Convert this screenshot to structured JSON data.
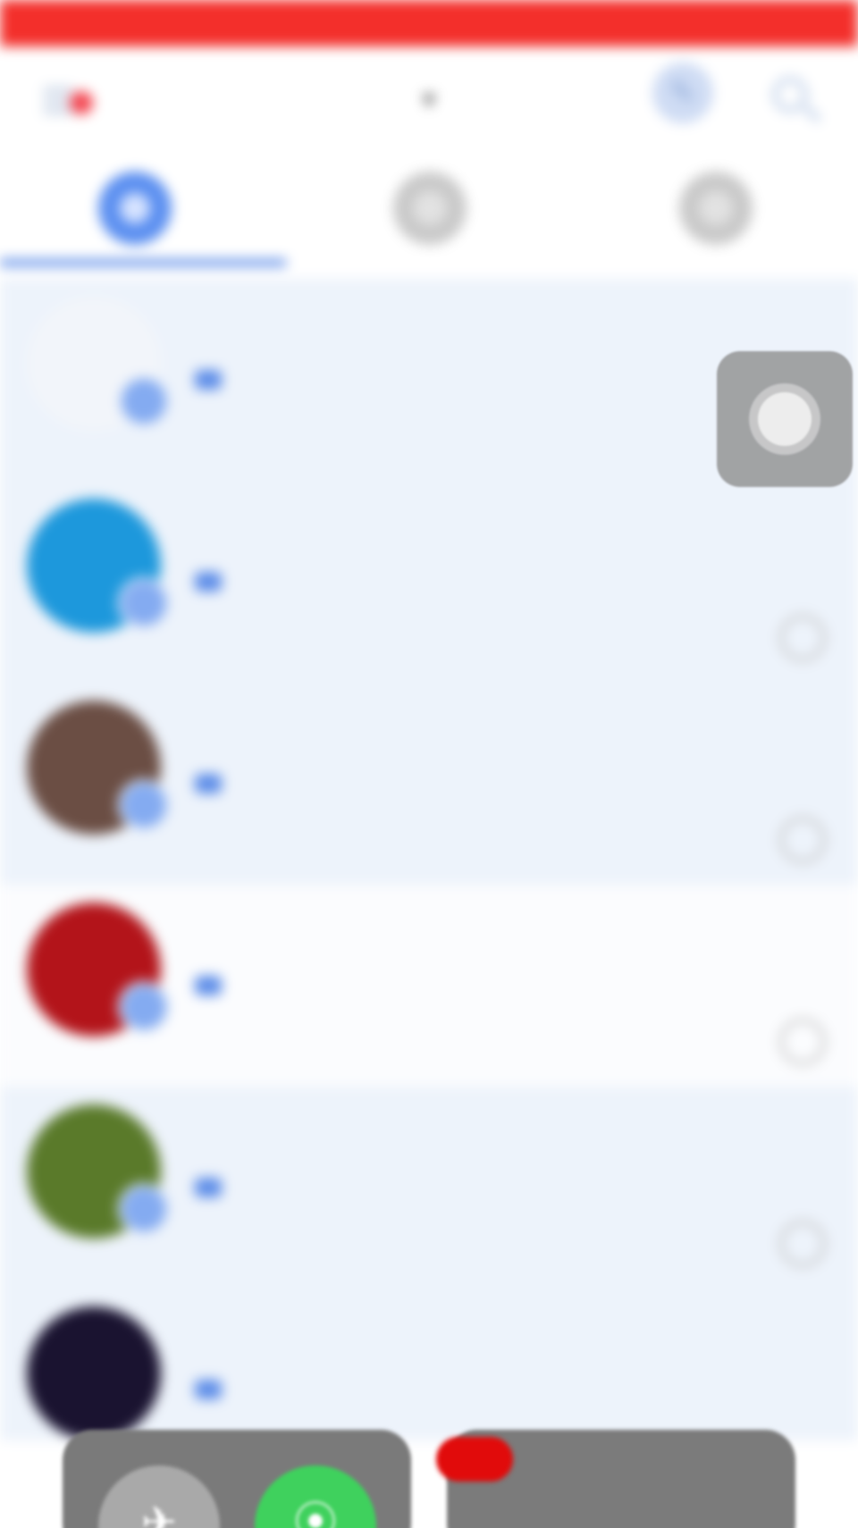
{
  "status_bar": {
    "carrier": "",
    "time": "",
    "battery": "",
    "color": "#f32f2b"
  },
  "header": {
    "title": "",
    "title_caret": "▾",
    "notification_dot": true,
    "accent": "#5d8de8"
  },
  "tabs": [
    {
      "label": "",
      "icon": "chat-bubble-icon",
      "active": true
    },
    {
      "label": "",
      "icon": "circle-icon",
      "active": false
    },
    {
      "label": "",
      "icon": "circle-icon",
      "active": false
    }
  ],
  "conversations": [
    {
      "name": "",
      "time": "",
      "subtitle": "",
      "preview": "",
      "avatar_color": "#f2f5fa",
      "muted": false,
      "highlight": false
    },
    {
      "name": "",
      "time": "",
      "subtitle": "",
      "preview": "",
      "avatar_color": "#1d98dc",
      "muted": true,
      "highlight": false
    },
    {
      "name": "",
      "time": "",
      "subtitle": "",
      "preview": "",
      "avatar_color": "#6b4e44",
      "muted": true,
      "highlight": false
    },
    {
      "name": "",
      "time": "",
      "subtitle": "",
      "preview": "",
      "avatar_color": "#b3141a",
      "muted": true,
      "highlight": true
    },
    {
      "name": "",
      "time": "",
      "subtitle": "",
      "preview": "",
      "avatar_color": "#5a7a2a",
      "muted": true,
      "highlight": false
    },
    {
      "name": "",
      "time": "",
      "subtitle": "",
      "preview": "",
      "avatar_color": "#1a1330",
      "muted": false,
      "highlight": false
    }
  ],
  "control_center": {
    "airplane_icon": "airplane-icon",
    "cellular_icon": "cellular-antenna-icon",
    "cellular_color": "#3fd15d"
  },
  "assistive_touch_icon": "assistive-touch-icon"
}
